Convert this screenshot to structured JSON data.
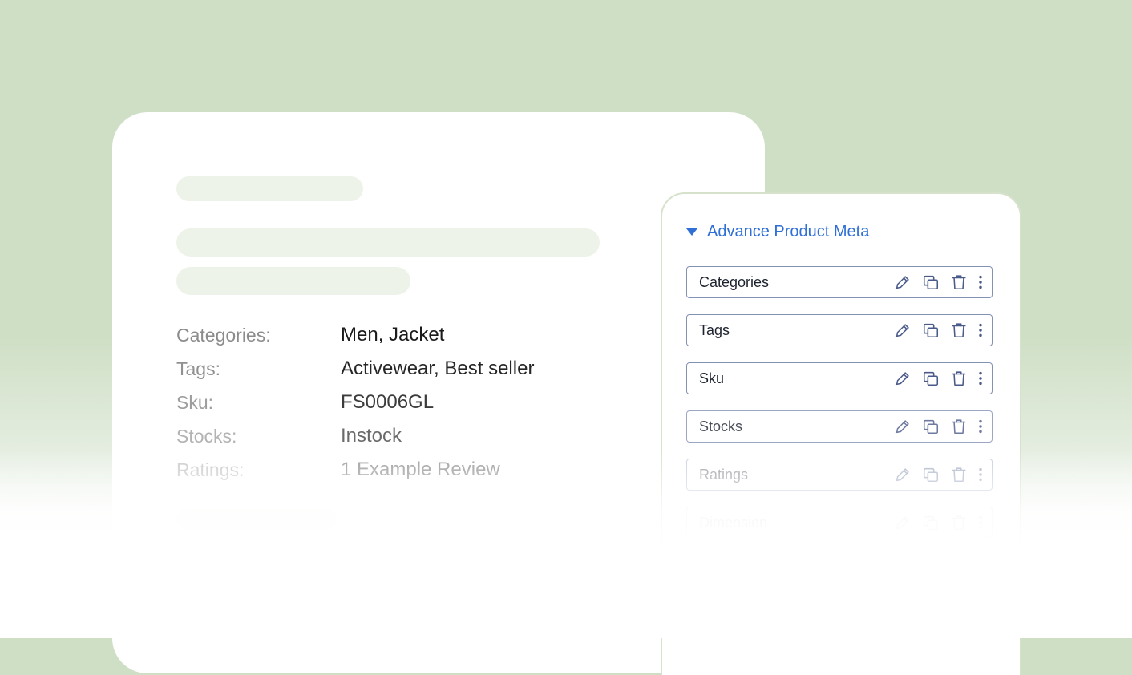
{
  "product_meta": {
    "rows": [
      {
        "label": "Categories:",
        "value": "Men, Jacket"
      },
      {
        "label": "Tags:",
        "value": "Activewear, Best seller"
      },
      {
        "label": "Sku:",
        "value": "FS0006GL"
      },
      {
        "label": "Stocks:",
        "value": "Instock"
      },
      {
        "label": "Ratings:",
        "value": "1 Example Review"
      }
    ]
  },
  "panel": {
    "title": "Advance Product Meta",
    "fields": [
      {
        "label": "Categories"
      },
      {
        "label": "Tags"
      },
      {
        "label": "Sku"
      },
      {
        "label": "Stocks"
      },
      {
        "label": "Ratings"
      },
      {
        "label": "Dimension"
      }
    ],
    "field_actions": [
      "pencil-icon",
      "duplicate-icon",
      "trash-icon",
      "more-vertical-icon"
    ]
  },
  "colors": {
    "background": "#cfdfc5",
    "accent": "#2f6fd6",
    "field_border": "#8391b4",
    "icon": "#4a5a8a",
    "skeleton": "#eef3ea"
  }
}
